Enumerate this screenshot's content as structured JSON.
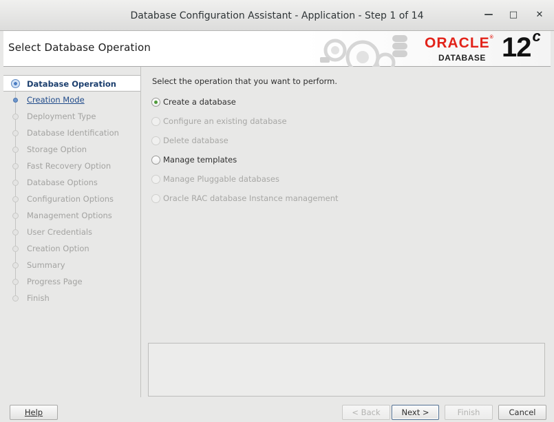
{
  "window": {
    "title": "Database Configuration Assistant - Application - Step 1 of 14",
    "minimize_glyph": "—",
    "maximize_glyph": "□",
    "close_glyph": "✕"
  },
  "header": {
    "step_title": "Select Database Operation",
    "brand": {
      "oracle": "ORACLE",
      "registered": "®",
      "database": "DATABASE",
      "version": "12",
      "version_suffix": "c"
    }
  },
  "nav": {
    "items": [
      {
        "label": "Database Operation",
        "state": "current"
      },
      {
        "label": "Creation Mode",
        "state": "link"
      },
      {
        "label": "Deployment Type",
        "state": "disabled"
      },
      {
        "label": "Database Identification",
        "state": "disabled"
      },
      {
        "label": "Storage Option",
        "state": "disabled"
      },
      {
        "label": "Fast Recovery Option",
        "state": "disabled"
      },
      {
        "label": "Database Options",
        "state": "disabled"
      },
      {
        "label": "Configuration Options",
        "state": "disabled"
      },
      {
        "label": "Management Options",
        "state": "disabled"
      },
      {
        "label": "User Credentials",
        "state": "disabled"
      },
      {
        "label": "Creation Option",
        "state": "disabled"
      },
      {
        "label": "Summary",
        "state": "disabled"
      },
      {
        "label": "Progress Page",
        "state": "disabled"
      },
      {
        "label": "Finish",
        "state": "disabled"
      }
    ]
  },
  "main": {
    "prompt": "Select the operation that you want to perform.",
    "options": [
      {
        "label": "Create a database",
        "selected": true,
        "enabled": true
      },
      {
        "label": "Configure an existing database",
        "selected": false,
        "enabled": false
      },
      {
        "label": "Delete database",
        "selected": false,
        "enabled": false
      },
      {
        "label": "Manage templates",
        "selected": false,
        "enabled": true
      },
      {
        "label": "Manage Pluggable databases",
        "selected": false,
        "enabled": false
      },
      {
        "label": "Oracle RAC database Instance management",
        "selected": false,
        "enabled": false
      }
    ]
  },
  "footer": {
    "help": "Help",
    "back": "< Back",
    "next": "Next >",
    "finish": "Finish",
    "cancel": "Cancel"
  },
  "colors": {
    "accent_red": "#e2231a",
    "nav_current": "#1c3f6e",
    "radio_selected": "#4e9a3a"
  }
}
